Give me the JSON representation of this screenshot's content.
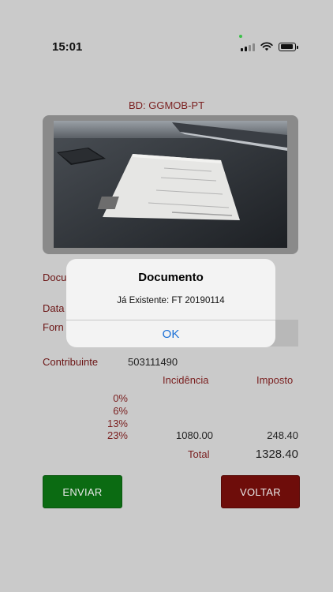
{
  "status_bar": {
    "time": "15:01"
  },
  "header": {
    "bd_label": "BD: GGMOB-PT"
  },
  "form": {
    "documento_label": "Docu",
    "data_label": "Data",
    "fornecedor_label": "Forn",
    "contribuinte_label": "Contribuinte",
    "contribuinte_value": "503111490"
  },
  "taxes": {
    "incidencia_header": "Incidência",
    "imposto_header": "Imposto",
    "rows": [
      {
        "rate": "0%",
        "incidencia": "",
        "imposto": ""
      },
      {
        "rate": "6%",
        "incidencia": "",
        "imposto": ""
      },
      {
        "rate": "13%",
        "incidencia": "",
        "imposto": ""
      },
      {
        "rate": "23%",
        "incidencia": "1080.00",
        "imposto": "248.40"
      }
    ],
    "total_label": "Total",
    "total_value": "1328.40"
  },
  "buttons": {
    "enviar": "ENVIAR",
    "voltar": "VOLTAR"
  },
  "alert": {
    "title": "Documento",
    "message": "Já Existente: FT 20190114",
    "ok_label": "OK"
  },
  "colors": {
    "label_red": "#7a1f1f",
    "enviar_green": "#0b6b12",
    "voltar_red": "#6e0d0a",
    "ios_blue": "#1a6fd6"
  }
}
